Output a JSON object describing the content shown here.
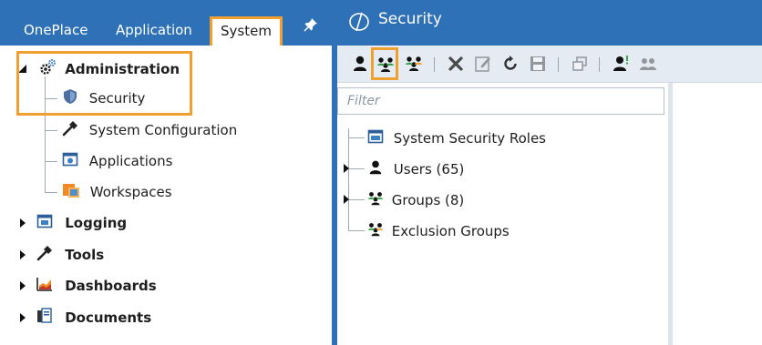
{
  "left_panel": {
    "tabs": [
      {
        "label": "OnePlace",
        "selected": false
      },
      {
        "label": "Application",
        "selected": false
      },
      {
        "label": "System",
        "selected": true
      }
    ],
    "pin_icon": "pin-icon",
    "tree": {
      "administration": {
        "label": "Administration",
        "expanded": true,
        "children": {
          "security": "Security",
          "system_configuration": "System Configuration",
          "applications": "Applications",
          "workspaces": "Workspaces"
        }
      },
      "logging": "Logging",
      "tools": "Tools",
      "dashboards": "Dashboards",
      "documents": "Documents"
    }
  },
  "right_panel": {
    "title": "Security",
    "filter_placeholder": "Filter",
    "toolbar_icons": [
      "user-icon",
      "group-icon",
      "exclusion-group-icon",
      "delete-icon",
      "edit-icon",
      "refresh-icon",
      "save-icon",
      "copy-icon",
      "user-alert-icon",
      "user-group-alert-icon"
    ],
    "tree": {
      "system_security_roles": "System Security Roles",
      "users": "Users (65)",
      "groups": "Groups (8)",
      "exclusion_groups": "Exclusion Groups"
    }
  },
  "colors": {
    "header_blue": "#2f71b6",
    "highlight_orange": "#f0a030",
    "toolbar_bg": "#e4ebf3"
  }
}
